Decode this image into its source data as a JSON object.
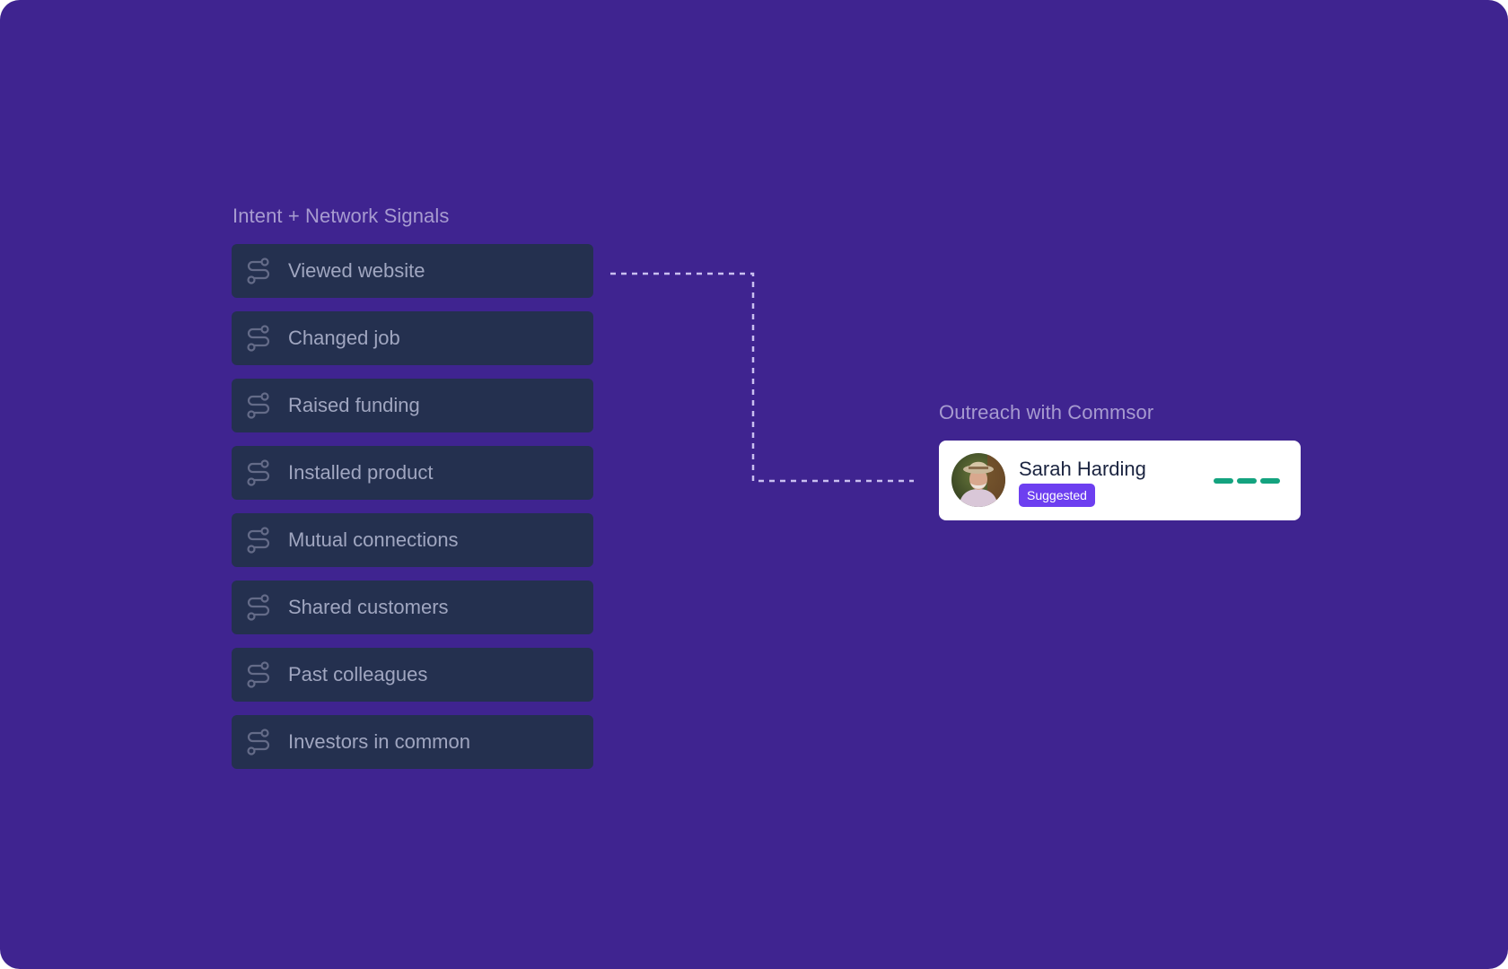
{
  "signals": {
    "title": "Intent + Network Signals",
    "items": [
      {
        "label": "Viewed website",
        "icon": "signal-route-icon"
      },
      {
        "label": "Changed job",
        "icon": "signal-route-icon"
      },
      {
        "label": "Raised funding",
        "icon": "signal-route-icon"
      },
      {
        "label": "Installed product",
        "icon": "signal-route-icon"
      },
      {
        "label": "Mutual connections",
        "icon": "signal-route-icon"
      },
      {
        "label": "Shared customers",
        "icon": "signal-route-icon"
      },
      {
        "label": "Past colleagues",
        "icon": "signal-route-icon"
      },
      {
        "label": "Investors in common",
        "icon": "signal-route-icon"
      }
    ]
  },
  "outreach": {
    "title": "Outreach with Commsor",
    "contact": {
      "name": "Sarah Harding",
      "badge": "Suggested",
      "steps_total": 3,
      "steps_complete": 3
    }
  },
  "colors": {
    "background": "#3f2490",
    "signal_card": "#24304f",
    "badge": "#6d3ff0",
    "progress": "#14a37f",
    "connector": "#c9bff0"
  }
}
